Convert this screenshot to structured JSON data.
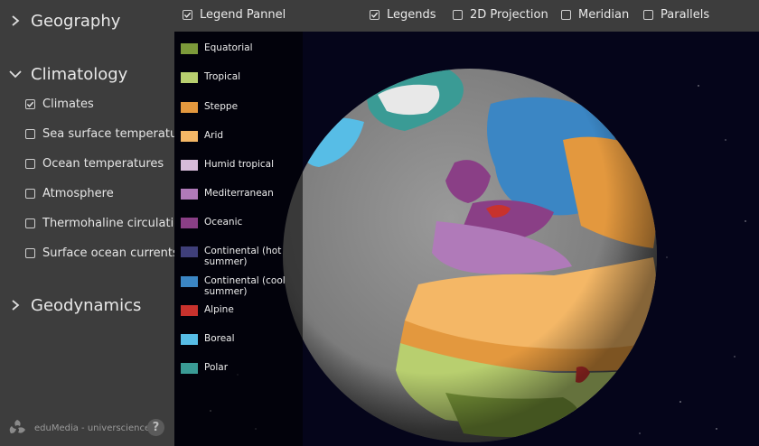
{
  "sidebar": {
    "sections": [
      {
        "title": "Geography",
        "expanded": false
      },
      {
        "title": "Climatology",
        "expanded": true
      },
      {
        "title": "Geodynamics",
        "expanded": false
      }
    ],
    "climatology_options": [
      {
        "label": "Climates",
        "checked": true
      },
      {
        "label": "Sea surface temperatures",
        "checked": false
      },
      {
        "label": "Ocean temperatures",
        "checked": false
      },
      {
        "label": "Atmosphere",
        "checked": false
      },
      {
        "label": "Thermohaline circulation",
        "checked": false
      },
      {
        "label": "Surface ocean currents",
        "checked": false
      }
    ],
    "footer": {
      "brand": "eduMedia - universcience",
      "help": "?"
    }
  },
  "topbar": {
    "legend_panel": {
      "label": "Legend Pannel",
      "checked": true
    },
    "legends": {
      "label": "Legends",
      "checked": true
    },
    "projection_2d": {
      "label": "2D Projection",
      "checked": false
    },
    "meridian": {
      "label": "Meridian",
      "checked": false
    },
    "parallels": {
      "label": "Parallels",
      "checked": false
    }
  },
  "legend": [
    {
      "label": "Equatorial",
      "color": "#7c9a3a"
    },
    {
      "label": "Tropical",
      "color": "#b8cf6f"
    },
    {
      "label": "Steppe",
      "color": "#e3983e"
    },
    {
      "label": "Arid",
      "color": "#f4b766"
    },
    {
      "label": "Humid tropical",
      "color": "#d7bbd9"
    },
    {
      "label": "Mediterranean",
      "color": "#b07ab9"
    },
    {
      "label": "Oceanic",
      "color": "#8a3f86"
    },
    {
      "label": "Continental (hot summer)",
      "color": "#3f3f7a"
    },
    {
      "label": "Continental (cool summer)",
      "color": "#3b86c4"
    },
    {
      "label": "Alpine",
      "color": "#c8322d"
    },
    {
      "label": "Boreal",
      "color": "#57bde6"
    },
    {
      "label": "Polar",
      "color": "#3a9b95"
    }
  ]
}
